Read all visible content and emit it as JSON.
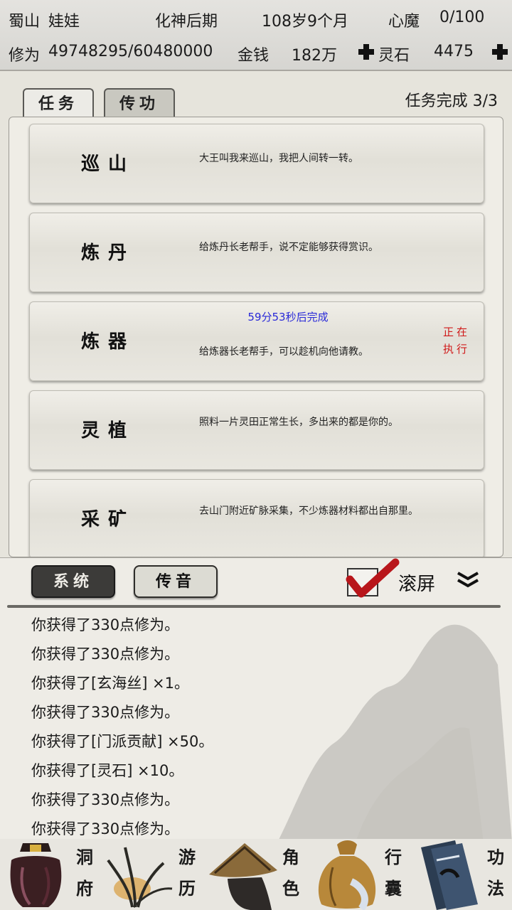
{
  "status": {
    "sect": "蜀山",
    "player_name": "娃娃",
    "realm": "化神后期",
    "age": "108岁9个月",
    "heart_demon_label": "心魔",
    "heart_demon_value": "0/100",
    "cultivation_label": "修为",
    "cultivation_value": "49748295/60480000",
    "money_label": "金钱",
    "money_value": "182万",
    "spirit_stone_label": "灵石",
    "spirit_stone_value": "4475"
  },
  "tasks": {
    "tabs": [
      "任务",
      "传功"
    ],
    "progress_label": "任务完成",
    "progress_value": "3/3",
    "items": [
      {
        "name": "巡山",
        "desc": "大王叫我来巡山，我把人间转一转。"
      },
      {
        "name": "炼丹",
        "desc": "给炼丹长老帮手，说不定能够获得赏识。"
      },
      {
        "name": "炼器",
        "desc": "给炼器长老帮手，可以趁机向他请教。",
        "timer": "59分53秒后完成",
        "state": "正在执行"
      },
      {
        "name": "灵植",
        "desc": "照料一片灵田正常生长，多出来的都是你的。"
      },
      {
        "name": "采矿",
        "desc": "去山门附近矿脉采集，不少炼器材料都出自那里。"
      }
    ]
  },
  "log": {
    "tabs": [
      "系统",
      "传音"
    ],
    "auto_scroll_label": "滚屏",
    "auto_scroll_checked": true,
    "lines": [
      "你获得了330点修为。",
      "你获得了330点修为。",
      "你获得了[玄海丝] ×1。",
      "你获得了330点修为。",
      "你获得了[门派贡献] ×50。",
      "你获得了[灵石] ×10。",
      "你获得了330点修为。",
      "你获得了330点修为。"
    ]
  },
  "nav": {
    "items": [
      {
        "label_top": "洞",
        "label_bottom": "府",
        "icon": "lantern-icon"
      },
      {
        "label_top": "游",
        "label_bottom": "历",
        "icon": "grass-icon"
      },
      {
        "label_top": "角",
        "label_bottom": "色",
        "icon": "straw-hat-icon"
      },
      {
        "label_top": "行",
        "label_bottom": "囊",
        "icon": "bag-icon"
      },
      {
        "label_top": "功",
        "label_bottom": "法",
        "icon": "book-icon"
      }
    ]
  },
  "colors": {
    "timer": "#2a2ad8",
    "running": "#d01a1a",
    "check": "#b8161b"
  }
}
